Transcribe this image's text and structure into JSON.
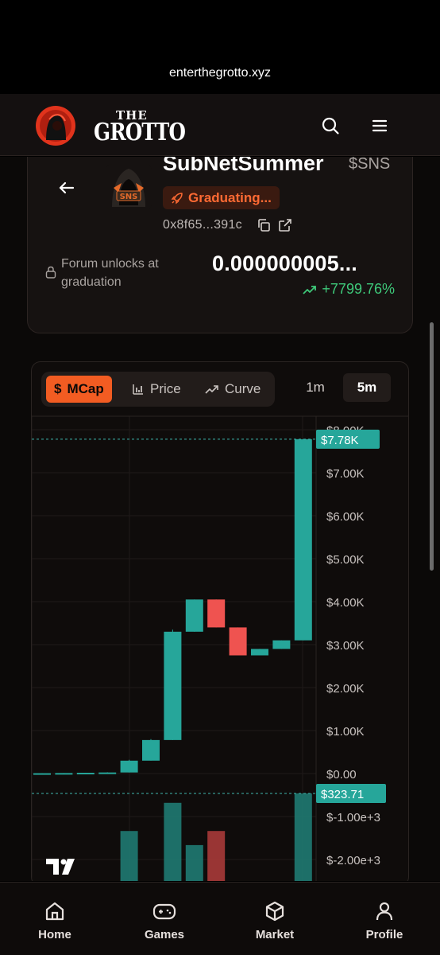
{
  "browser": {
    "url": "enterthegrotto.xyz"
  },
  "header": {
    "brand_top": "THE",
    "brand_main": "GROTTO",
    "icons": [
      "search-icon",
      "menu-icon"
    ]
  },
  "token": {
    "name": "SubNetSummer",
    "ticker": "$SNS",
    "status": "Graduating...",
    "address": "0x8f65...391c",
    "forum_text": "Forum unlocks at graduation",
    "price": "0.000000005...",
    "change": "+7799.76%",
    "colors": {
      "accent": "#f25c22",
      "up": "#3ec97a"
    }
  },
  "chart": {
    "modes": [
      {
        "label": "MCap",
        "icon": "dollar-icon",
        "active": true
      },
      {
        "label": "Price",
        "icon": "bar-chart-icon",
        "active": false
      },
      {
        "label": "Curve",
        "icon": "trend-icon",
        "active": false
      }
    ],
    "timeframes": [
      {
        "label": "1m",
        "active": false
      },
      {
        "label": "5m",
        "active": true
      }
    ],
    "last_value_label": "$7.78K",
    "volume_label": "$323.71"
  },
  "chart_data": {
    "type": "candlestick",
    "y_ticks": [
      "$8.00K",
      "$7.00K",
      "$6.00K",
      "$5.00K",
      "$4.00K",
      "$3.00K",
      "$2.00K",
      "$1.00K",
      "$0.00",
      "$-1.00e+3",
      "$-2.00e+3"
    ],
    "ylim": [
      -2000,
      8000
    ],
    "candles": [
      {
        "open": 5,
        "high": 10,
        "low": 0,
        "close": 8
      },
      {
        "open": 8,
        "high": 12,
        "low": 5,
        "close": 12
      },
      {
        "open": 12,
        "high": 18,
        "low": 10,
        "close": 18
      },
      {
        "open": 18,
        "high": 30,
        "low": 15,
        "close": 25
      },
      {
        "open": 25,
        "high": 320,
        "low": 25,
        "close": 300
      },
      {
        "open": 300,
        "high": 800,
        "low": 300,
        "close": 780
      },
      {
        "open": 780,
        "high": 3350,
        "low": 780,
        "close": 3300
      },
      {
        "open": 3300,
        "high": 4050,
        "low": 3300,
        "close": 4050
      },
      {
        "open": 4050,
        "high": 4050,
        "low": 3400,
        "close": 3400
      },
      {
        "open": 3400,
        "high": 3400,
        "low": 2750,
        "close": 2750
      },
      {
        "open": 2750,
        "high": 2900,
        "low": 2750,
        "close": 2900
      },
      {
        "open": 2900,
        "high": 3100,
        "low": 2900,
        "close": 3100
      },
      {
        "open": 3100,
        "high": 7780,
        "low": 3100,
        "close": 7780
      }
    ],
    "volume": [
      null,
      null,
      null,
      null,
      0.6,
      null,
      0.9,
      0.45,
      0.6,
      null,
      null,
      null,
      1.0
    ],
    "last_value": 7780,
    "last_volume": 323.71
  },
  "bottom_nav": [
    {
      "label": "Home",
      "icon": "home-icon"
    },
    {
      "label": "Games",
      "icon": "gamepad-icon"
    },
    {
      "label": "Market",
      "icon": "cube-icon"
    },
    {
      "label": "Profile",
      "icon": "user-icon"
    }
  ]
}
